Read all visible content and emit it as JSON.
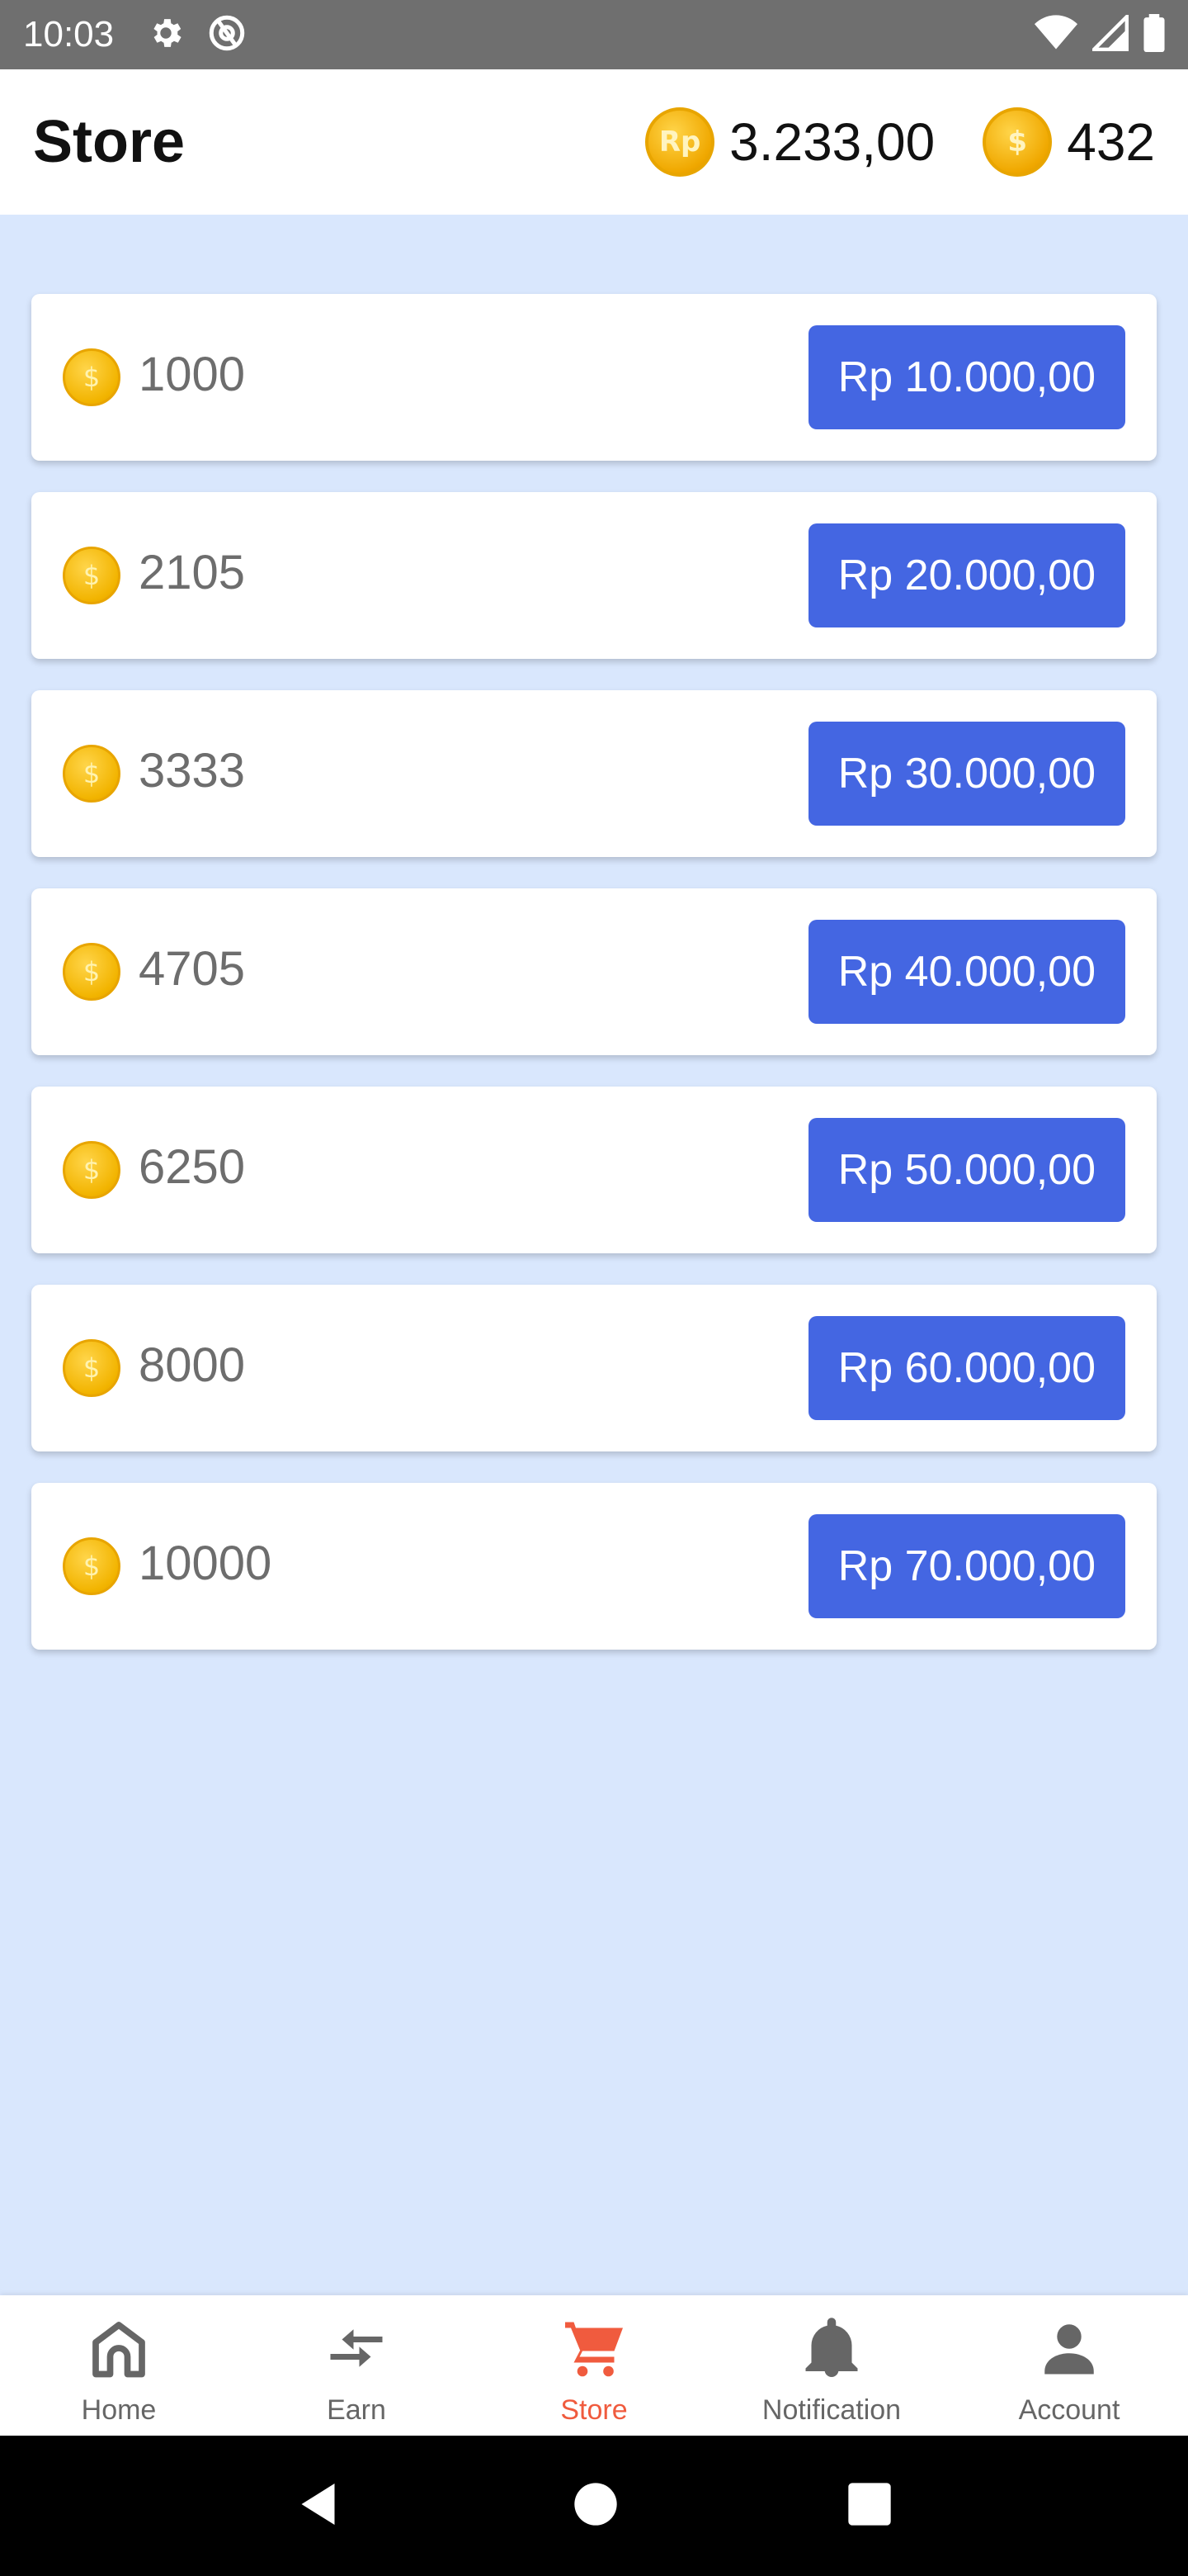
{
  "status_bar": {
    "time": "10:03",
    "icons_left": [
      "gear-icon",
      "at-sign-icon"
    ],
    "icons_right": [
      "wifi-icon",
      "signal-icon",
      "battery-icon"
    ]
  },
  "header": {
    "title": "Store",
    "money_balance": {
      "icon": "rp-coin-icon",
      "icon_text": "Rp",
      "value": "3.233,00"
    },
    "coin_balance": {
      "icon": "coin-icon",
      "icon_text": "$",
      "value": "432"
    }
  },
  "store": {
    "items": [
      {
        "coins": "1000",
        "price": "Rp 10.000,00"
      },
      {
        "coins": "2105",
        "price": "Rp 20.000,00"
      },
      {
        "coins": "3333",
        "price": "Rp 30.000,00"
      },
      {
        "coins": "4705",
        "price": "Rp 40.000,00"
      },
      {
        "coins": "6250",
        "price": "Rp 50.000,00"
      },
      {
        "coins": "8000",
        "price": "Rp 60.000,00"
      },
      {
        "coins": "10000",
        "price": "Rp 70.000,00"
      }
    ]
  },
  "bottom_nav": {
    "items": [
      {
        "label": "Home",
        "icon": "home-icon",
        "active": false
      },
      {
        "label": "Earn",
        "icon": "exchange-icon",
        "active": false
      },
      {
        "label": "Store",
        "icon": "cart-icon",
        "active": true
      },
      {
        "label": "Notification",
        "icon": "bell-icon",
        "active": false
      },
      {
        "label": "Account",
        "icon": "person-icon",
        "active": false
      }
    ]
  },
  "colors": {
    "background": "#d9e7fd",
    "button": "#4466e2",
    "active_nav": "#f05b3e",
    "coin": "#f2b400"
  }
}
